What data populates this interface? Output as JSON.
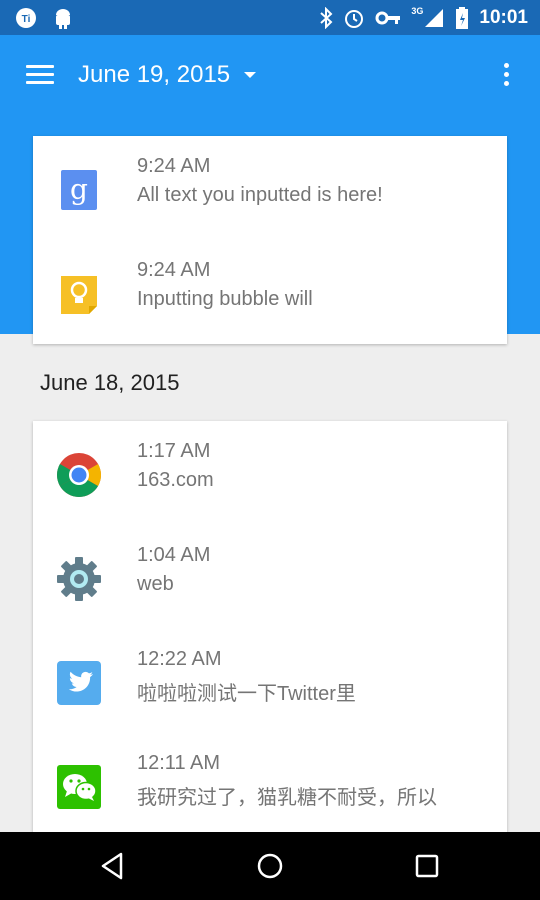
{
  "status_bar": {
    "time": "10:01",
    "network": "3G"
  },
  "app_bar": {
    "title": "June 19, 2015"
  },
  "groups": [
    {
      "date": "June 19, 2015",
      "items": [
        {
          "icon": "google-search-icon",
          "time": "9:24 AM",
          "text": "All text you inputted is here!"
        },
        {
          "icon": "lightbulb-icon",
          "time": "9:24 AM",
          "text": "Inputting bubble will"
        }
      ]
    },
    {
      "date": "June 18, 2015",
      "items": [
        {
          "icon": "chrome-icon",
          "time": "1:17 AM",
          "text": "163.com"
        },
        {
          "icon": "settings-gear-icon",
          "time": "1:04 AM",
          "text": "web"
        },
        {
          "icon": "twitter-icon",
          "time": "12:22 AM",
          "text": "啦啦啦测试一下Twitter里"
        },
        {
          "icon": "wechat-icon",
          "time": "12:11 AM",
          "text": "我研究过了，猫乳糖不耐受，所以"
        }
      ]
    }
  ],
  "colors": {
    "primary": "#2196f3",
    "status_bar": "#1a69b5",
    "background": "#eeeeee",
    "text_secondary": "#757575"
  }
}
